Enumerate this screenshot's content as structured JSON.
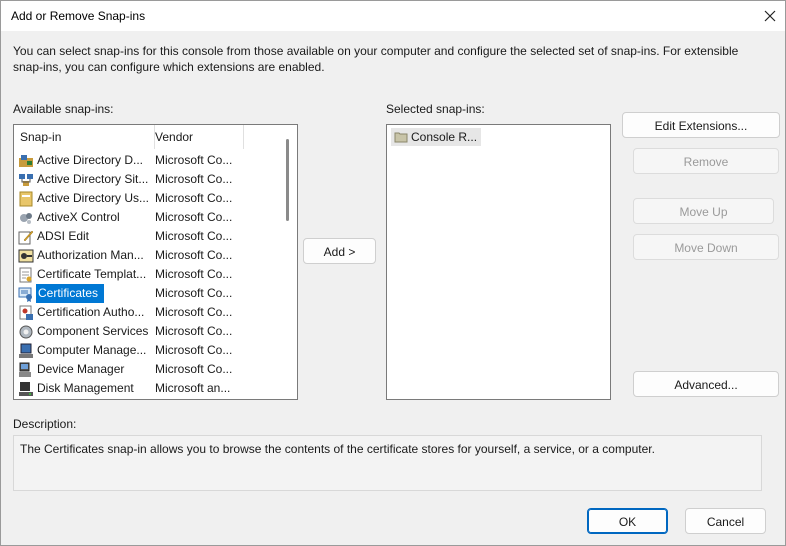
{
  "window": {
    "title": "Add or Remove Snap-ins"
  },
  "intro": "You can select snap-ins for this console from those available on your computer and configure the selected set of snap-ins. For extensible snap-ins, you can configure which extensions are enabled.",
  "available": {
    "label": "Available snap-ins:",
    "columns": {
      "snapin": "Snap-in",
      "vendor": "Vendor"
    },
    "items": [
      {
        "name": "Active Directory D...",
        "vendor": "Microsoft Co...",
        "icon": "ad-domains-icon"
      },
      {
        "name": "Active Directory Sit...",
        "vendor": "Microsoft Co...",
        "icon": "ad-sites-icon"
      },
      {
        "name": "Active Directory Us...",
        "vendor": "Microsoft Co...",
        "icon": "ad-users-icon"
      },
      {
        "name": "ActiveX Control",
        "vendor": "Microsoft Co...",
        "icon": "activex-icon"
      },
      {
        "name": "ADSI Edit",
        "vendor": "Microsoft Co...",
        "icon": "adsi-edit-icon"
      },
      {
        "name": "Authorization Man...",
        "vendor": "Microsoft Co...",
        "icon": "authorization-icon"
      },
      {
        "name": "Certificate Templat...",
        "vendor": "Microsoft Co...",
        "icon": "cert-template-icon"
      },
      {
        "name": "Certificates",
        "vendor": "Microsoft Co...",
        "icon": "certificates-icon",
        "selected": true
      },
      {
        "name": "Certification Autho...",
        "vendor": "Microsoft Co...",
        "icon": "cert-authority-icon"
      },
      {
        "name": "Component Services",
        "vendor": "Microsoft Co...",
        "icon": "component-services-icon"
      },
      {
        "name": "Computer Manage...",
        "vendor": "Microsoft Co...",
        "icon": "computer-management-icon"
      },
      {
        "name": "Device Manager",
        "vendor": "Microsoft Co...",
        "icon": "device-manager-icon"
      },
      {
        "name": "Disk Management",
        "vendor": "Microsoft an...",
        "icon": "disk-management-icon"
      }
    ]
  },
  "selected": {
    "label": "Selected snap-ins:",
    "items": [
      {
        "name": "Console R...",
        "icon": "folder-icon"
      }
    ]
  },
  "buttons": {
    "add": "Add >",
    "edit_extensions": "Edit Extensions...",
    "remove": "Remove",
    "move_up": "Move Up",
    "move_down": "Move Down",
    "advanced": "Advanced...",
    "ok": "OK",
    "cancel": "Cancel"
  },
  "description": {
    "label": "Description:",
    "text": "The Certificates snap-in allows you to browse the contents of the certificate stores for yourself, a service, or a computer."
  },
  "colors": {
    "selection": "#0078d4",
    "accent": "#0067c0"
  }
}
